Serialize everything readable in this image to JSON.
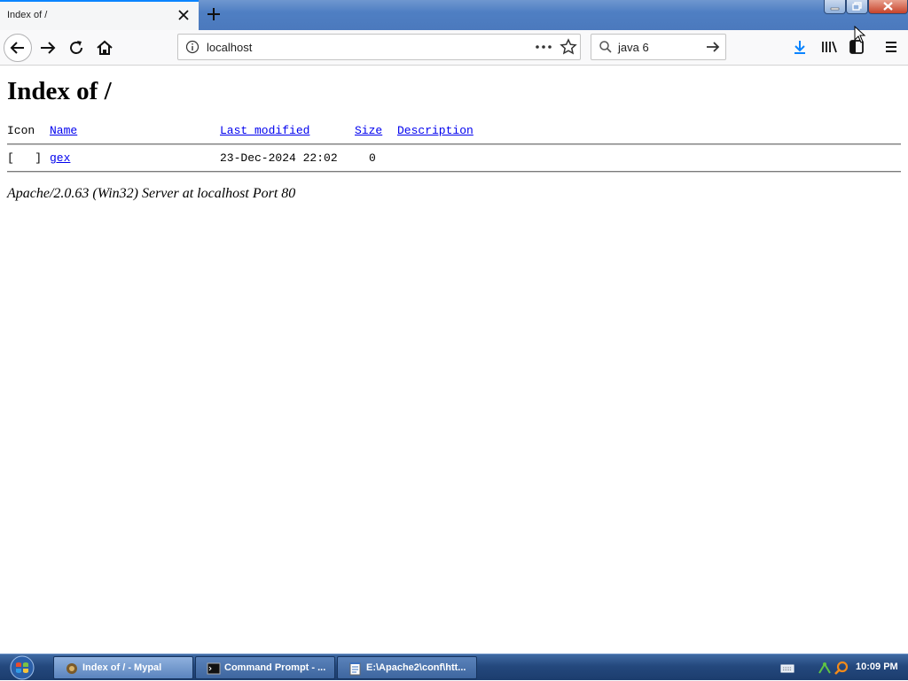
{
  "browser": {
    "tab_title": "Index of /",
    "url": "localhost",
    "search_query": "java 6"
  },
  "page": {
    "heading": "Index of /",
    "columns": {
      "icon": "Icon",
      "name": "Name",
      "last_modified": "Last modified",
      "size": "Size",
      "description": "Description"
    },
    "rows": [
      {
        "icon": "[   ]",
        "name": "gex",
        "last_modified": "23-Dec-2024 22:02",
        "size": "0",
        "description": ""
      }
    ],
    "server_signature": "Apache/2.0.63 (Win32) Server at localhost Port 80"
  },
  "taskbar": {
    "items": [
      {
        "label": "Index of / - Mypal",
        "icon": "mypal-icon",
        "active": true
      },
      {
        "label": "Command Prompt - ...",
        "icon": "cmd-icon",
        "active": false
      },
      {
        "label": "E:\\Apache2\\conf\\htt...",
        "icon": "notepad-icon",
        "active": false
      }
    ],
    "clock": "10:09 PM"
  },
  "colors": {
    "link": "#0000ee",
    "download_accent": "#0a84ff",
    "taskbar": "#24487d"
  }
}
